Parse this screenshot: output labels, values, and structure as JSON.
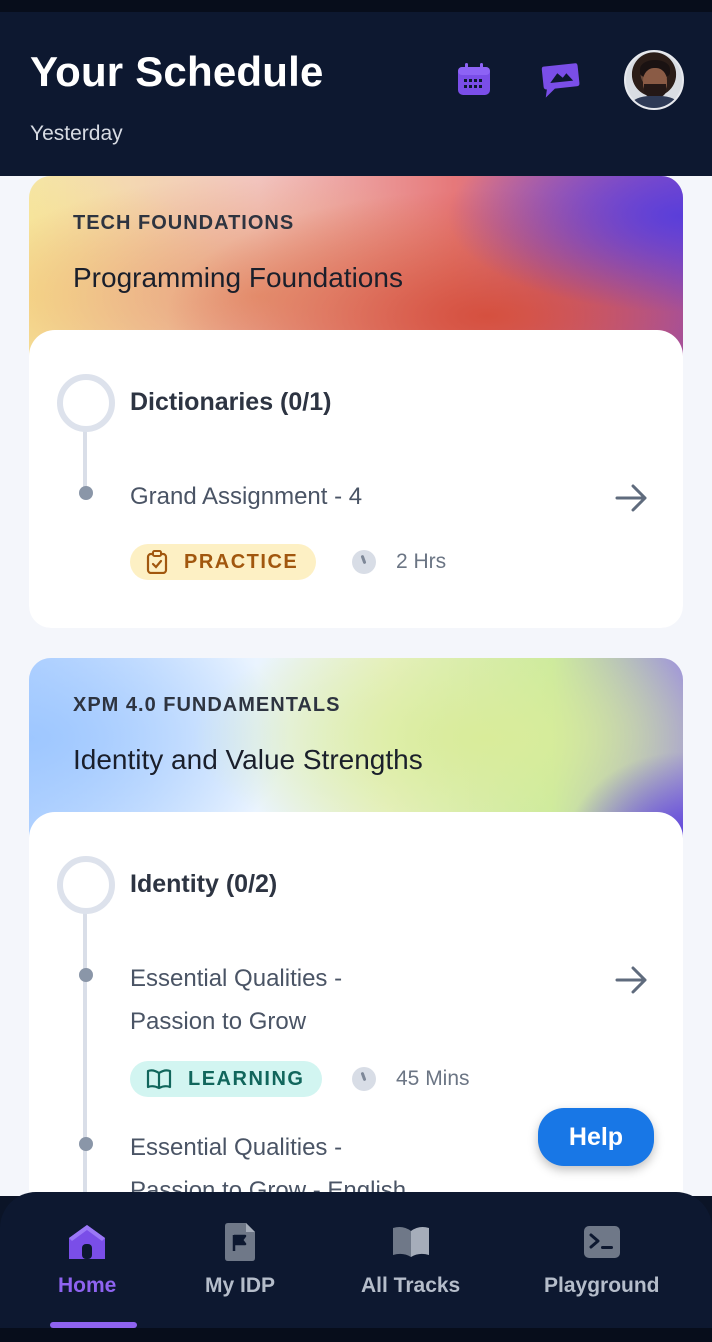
{
  "header": {
    "title": "Your Schedule",
    "subtitle": "Yesterday",
    "icons": [
      "calendar-icon",
      "chat-icon"
    ],
    "avatar": "user-avatar"
  },
  "cards": [
    {
      "category": "TECH FOUNDATIONS",
      "title": "Programming Foundations",
      "section": "Dictionaries (0/1)",
      "item_title": "Grand Assignment - 4",
      "badge": "PRACTICE",
      "duration": "2 Hrs"
    },
    {
      "category": "XPM 4.0 FUNDAMENTALS",
      "title": "Identity and Value Strengths",
      "section": "Identity (0/2)",
      "item1_line1": "Essential Qualities -",
      "item1_line2": "Passion to Grow",
      "badge": "LEARNING",
      "duration": "45 Mins",
      "item2_line1": "Essential Qualities -",
      "item2_line2": "Passion to Grow - English"
    }
  ],
  "help_label": "Help",
  "nav": {
    "items": [
      {
        "label": "Home",
        "icon": "home-icon",
        "active": true
      },
      {
        "label": "My IDP",
        "icon": "document-flag-icon",
        "active": false
      },
      {
        "label": "All Tracks",
        "icon": "book-icon",
        "active": false
      },
      {
        "label": "Playground",
        "icon": "terminal-icon",
        "active": false
      }
    ]
  },
  "colors": {
    "accent": "#8e63f0",
    "header_bg": "#0d1830",
    "help_button": "#1877e6",
    "practice_badge": "#fdf0c4",
    "learning_badge": "#d2f5f1"
  }
}
